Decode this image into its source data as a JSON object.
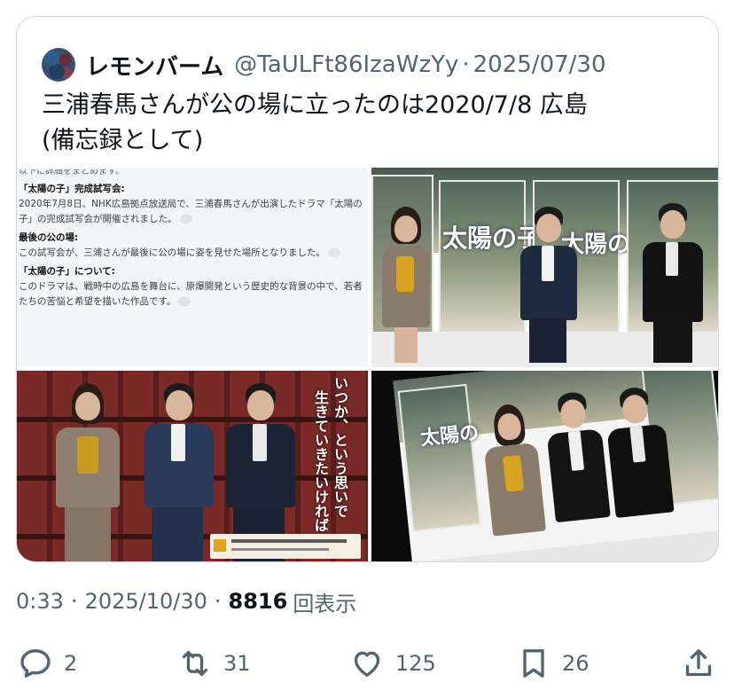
{
  "quote": {
    "author_name": "レモンバーム",
    "author_handle": "@TaULFt86IzaWzYy",
    "separator": "·",
    "date": "2025/07/30",
    "text": "三浦春馬さんが公の場に立ったのは2020/7/8 広島\n(備忘録として)"
  },
  "images": {
    "doc": {
      "cut_line": "以下に詳細をまとめます。",
      "h1": "「太陽の子」完成試写会:",
      "p1": "2020年7月8日、NHK広島拠点放送局で、三浦春馬さんが出演したドラマ「太陽の子」の完成試写会が開催されました。",
      "h2": "最後の公の場:",
      "p2": "この試写会が、三浦さんが最後に公の場に姿を見せた場所となりました。",
      "h3": "「太陽の子」について:",
      "p3": "このドラマは、戦時中の広島を舞台に、原爆開発という歴史的な背景の中で、若者たちの苦悩と希望を描いた作品です。"
    },
    "poster_title": "太陽の子",
    "poster_title_cut": "太陽の",
    "poster_title_cut2": "太陽の",
    "seated_caption_1": "いつか、という思いで",
    "seated_caption_2": "生きていきたいければ"
  },
  "meta": {
    "time": "0:33",
    "separator": "·",
    "date": "2025/10/30",
    "views": "8816",
    "views_label": "回表示"
  },
  "actions": {
    "replies": "2",
    "retweets": "31",
    "likes": "125",
    "bookmarks": "26"
  },
  "icons": [
    "reply-icon",
    "retweet-icon",
    "like-icon",
    "bookmark-icon",
    "share-icon"
  ]
}
